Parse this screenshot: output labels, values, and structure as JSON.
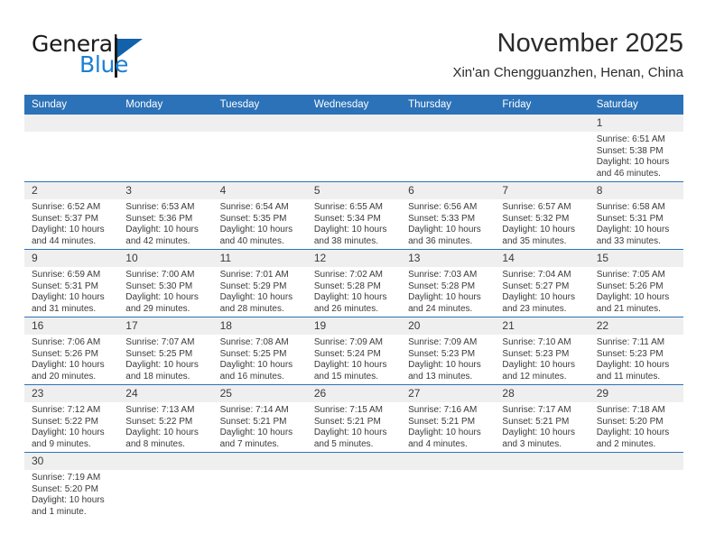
{
  "logo": {
    "word_one": "General",
    "word_two": "Blue",
    "triangle_icon": "blue-triangle-icon"
  },
  "header": {
    "title": "November 2025",
    "subtitle": "Xin'an Chengguanzhen, Henan, China"
  },
  "colors": {
    "header_blue": "#2c72b8",
    "row_divider_blue": "#2c72b8",
    "daynum_band_gray": "#efefef",
    "logo_blue": "#1b7fd4",
    "logo_triangle_blue": "#1261ab",
    "text": "#3a3a3a"
  },
  "weekdays": [
    "Sunday",
    "Monday",
    "Tuesday",
    "Wednesday",
    "Thursday",
    "Friday",
    "Saturday"
  ],
  "weeks": [
    [
      {
        "day": "",
        "empty": true
      },
      {
        "day": "",
        "empty": true
      },
      {
        "day": "",
        "empty": true
      },
      {
        "day": "",
        "empty": true
      },
      {
        "day": "",
        "empty": true
      },
      {
        "day": "",
        "empty": true
      },
      {
        "day": "1",
        "sunrise": "Sunrise: 6:51 AM",
        "sunset": "Sunset: 5:38 PM",
        "daylight_line1": "Daylight: 10 hours",
        "daylight_line2": "and 46 minutes."
      }
    ],
    [
      {
        "day": "2",
        "sunrise": "Sunrise: 6:52 AM",
        "sunset": "Sunset: 5:37 PM",
        "daylight_line1": "Daylight: 10 hours",
        "daylight_line2": "and 44 minutes."
      },
      {
        "day": "3",
        "sunrise": "Sunrise: 6:53 AM",
        "sunset": "Sunset: 5:36 PM",
        "daylight_line1": "Daylight: 10 hours",
        "daylight_line2": "and 42 minutes."
      },
      {
        "day": "4",
        "sunrise": "Sunrise: 6:54 AM",
        "sunset": "Sunset: 5:35 PM",
        "daylight_line1": "Daylight: 10 hours",
        "daylight_line2": "and 40 minutes."
      },
      {
        "day": "5",
        "sunrise": "Sunrise: 6:55 AM",
        "sunset": "Sunset: 5:34 PM",
        "daylight_line1": "Daylight: 10 hours",
        "daylight_line2": "and 38 minutes."
      },
      {
        "day": "6",
        "sunrise": "Sunrise: 6:56 AM",
        "sunset": "Sunset: 5:33 PM",
        "daylight_line1": "Daylight: 10 hours",
        "daylight_line2": "and 36 minutes."
      },
      {
        "day": "7",
        "sunrise": "Sunrise: 6:57 AM",
        "sunset": "Sunset: 5:32 PM",
        "daylight_line1": "Daylight: 10 hours",
        "daylight_line2": "and 35 minutes."
      },
      {
        "day": "8",
        "sunrise": "Sunrise: 6:58 AM",
        "sunset": "Sunset: 5:31 PM",
        "daylight_line1": "Daylight: 10 hours",
        "daylight_line2": "and 33 minutes."
      }
    ],
    [
      {
        "day": "9",
        "sunrise": "Sunrise: 6:59 AM",
        "sunset": "Sunset: 5:31 PM",
        "daylight_line1": "Daylight: 10 hours",
        "daylight_line2": "and 31 minutes."
      },
      {
        "day": "10",
        "sunrise": "Sunrise: 7:00 AM",
        "sunset": "Sunset: 5:30 PM",
        "daylight_line1": "Daylight: 10 hours",
        "daylight_line2": "and 29 minutes."
      },
      {
        "day": "11",
        "sunrise": "Sunrise: 7:01 AM",
        "sunset": "Sunset: 5:29 PM",
        "daylight_line1": "Daylight: 10 hours",
        "daylight_line2": "and 28 minutes."
      },
      {
        "day": "12",
        "sunrise": "Sunrise: 7:02 AM",
        "sunset": "Sunset: 5:28 PM",
        "daylight_line1": "Daylight: 10 hours",
        "daylight_line2": "and 26 minutes."
      },
      {
        "day": "13",
        "sunrise": "Sunrise: 7:03 AM",
        "sunset": "Sunset: 5:28 PM",
        "daylight_line1": "Daylight: 10 hours",
        "daylight_line2": "and 24 minutes."
      },
      {
        "day": "14",
        "sunrise": "Sunrise: 7:04 AM",
        "sunset": "Sunset: 5:27 PM",
        "daylight_line1": "Daylight: 10 hours",
        "daylight_line2": "and 23 minutes."
      },
      {
        "day": "15",
        "sunrise": "Sunrise: 7:05 AM",
        "sunset": "Sunset: 5:26 PM",
        "daylight_line1": "Daylight: 10 hours",
        "daylight_line2": "and 21 minutes."
      }
    ],
    [
      {
        "day": "16",
        "sunrise": "Sunrise: 7:06 AM",
        "sunset": "Sunset: 5:26 PM",
        "daylight_line1": "Daylight: 10 hours",
        "daylight_line2": "and 20 minutes."
      },
      {
        "day": "17",
        "sunrise": "Sunrise: 7:07 AM",
        "sunset": "Sunset: 5:25 PM",
        "daylight_line1": "Daylight: 10 hours",
        "daylight_line2": "and 18 minutes."
      },
      {
        "day": "18",
        "sunrise": "Sunrise: 7:08 AM",
        "sunset": "Sunset: 5:25 PM",
        "daylight_line1": "Daylight: 10 hours",
        "daylight_line2": "and 16 minutes."
      },
      {
        "day": "19",
        "sunrise": "Sunrise: 7:09 AM",
        "sunset": "Sunset: 5:24 PM",
        "daylight_line1": "Daylight: 10 hours",
        "daylight_line2": "and 15 minutes."
      },
      {
        "day": "20",
        "sunrise": "Sunrise: 7:09 AM",
        "sunset": "Sunset: 5:23 PM",
        "daylight_line1": "Daylight: 10 hours",
        "daylight_line2": "and 13 minutes."
      },
      {
        "day": "21",
        "sunrise": "Sunrise: 7:10 AM",
        "sunset": "Sunset: 5:23 PM",
        "daylight_line1": "Daylight: 10 hours",
        "daylight_line2": "and 12 minutes."
      },
      {
        "day": "22",
        "sunrise": "Sunrise: 7:11 AM",
        "sunset": "Sunset: 5:23 PM",
        "daylight_line1": "Daylight: 10 hours",
        "daylight_line2": "and 11 minutes."
      }
    ],
    [
      {
        "day": "23",
        "sunrise": "Sunrise: 7:12 AM",
        "sunset": "Sunset: 5:22 PM",
        "daylight_line1": "Daylight: 10 hours",
        "daylight_line2": "and 9 minutes."
      },
      {
        "day": "24",
        "sunrise": "Sunrise: 7:13 AM",
        "sunset": "Sunset: 5:22 PM",
        "daylight_line1": "Daylight: 10 hours",
        "daylight_line2": "and 8 minutes."
      },
      {
        "day": "25",
        "sunrise": "Sunrise: 7:14 AM",
        "sunset": "Sunset: 5:21 PM",
        "daylight_line1": "Daylight: 10 hours",
        "daylight_line2": "and 7 minutes."
      },
      {
        "day": "26",
        "sunrise": "Sunrise: 7:15 AM",
        "sunset": "Sunset: 5:21 PM",
        "daylight_line1": "Daylight: 10 hours",
        "daylight_line2": "and 5 minutes."
      },
      {
        "day": "27",
        "sunrise": "Sunrise: 7:16 AM",
        "sunset": "Sunset: 5:21 PM",
        "daylight_line1": "Daylight: 10 hours",
        "daylight_line2": "and 4 minutes."
      },
      {
        "day": "28",
        "sunrise": "Sunrise: 7:17 AM",
        "sunset": "Sunset: 5:21 PM",
        "daylight_line1": "Daylight: 10 hours",
        "daylight_line2": "and 3 minutes."
      },
      {
        "day": "29",
        "sunrise": "Sunrise: 7:18 AM",
        "sunset": "Sunset: 5:20 PM",
        "daylight_line1": "Daylight: 10 hours",
        "daylight_line2": "and 2 minutes."
      }
    ],
    [
      {
        "day": "30",
        "sunrise": "Sunrise: 7:19 AM",
        "sunset": "Sunset: 5:20 PM",
        "daylight_line1": "Daylight: 10 hours",
        "daylight_line2": "and 1 minute."
      },
      {
        "day": "",
        "empty": true
      },
      {
        "day": "",
        "empty": true
      },
      {
        "day": "",
        "empty": true
      },
      {
        "day": "",
        "empty": true
      },
      {
        "day": "",
        "empty": true
      },
      {
        "day": "",
        "empty": true
      }
    ]
  ]
}
